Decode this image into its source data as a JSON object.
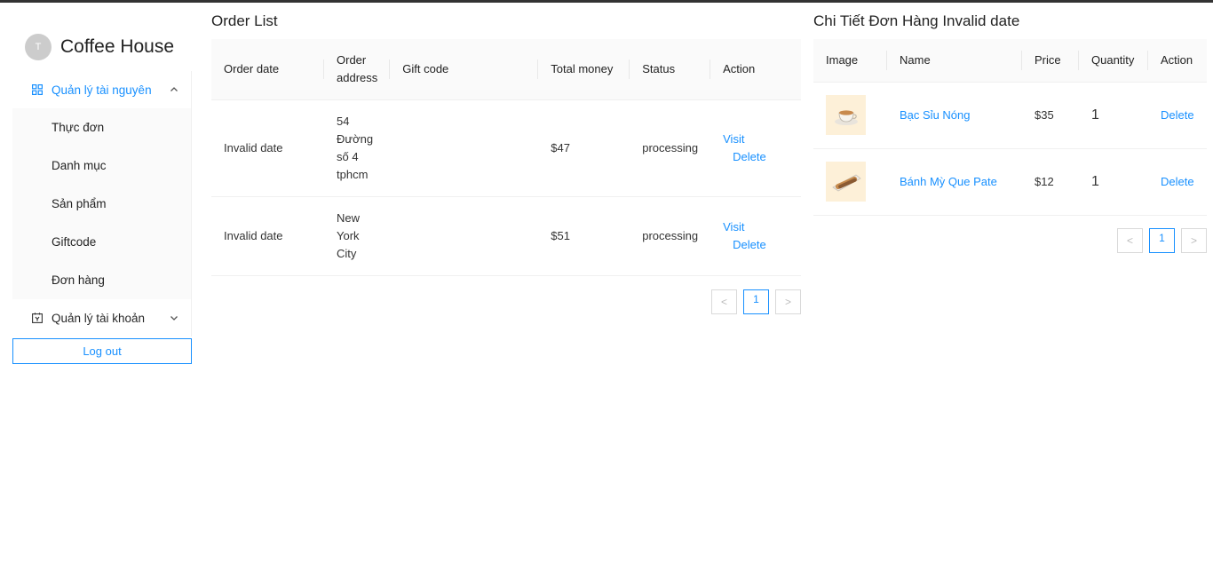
{
  "app": {
    "avatar_letter": "T",
    "brand": "Coffee House"
  },
  "colors": {
    "accent": "#1890ff",
    "header_bg": "#fafafa",
    "thumb_bg": "#fdf0d8"
  },
  "sidebar": {
    "resource_menu": {
      "label": "Quản lý tài nguyên",
      "icon": "appstore-icon",
      "expanded": true,
      "items": [
        "Thực đơn",
        "Danh mục",
        "Sản phẩm",
        "Giftcode",
        "Đơn hàng"
      ]
    },
    "account_menu": {
      "label": "Quản lý tài khoản",
      "icon": "contacts-icon",
      "expanded": false
    },
    "logout_label": "Log out"
  },
  "orders": {
    "title": "Order List",
    "columns": [
      "Order date",
      "Order address",
      "Gift code",
      "Total money",
      "Status",
      "Action"
    ],
    "rows": [
      {
        "date": "Invalid date",
        "address_lines": [
          "54",
          "Đường",
          "số 4",
          "tphcm"
        ],
        "gift_code": "",
        "total": "$47",
        "status": "processing",
        "visit": "Visit",
        "delete": "Delete"
      },
      {
        "date": "Invalid date",
        "address_lines": [
          "New",
          "York",
          "City"
        ],
        "gift_code": "",
        "total": "$51",
        "status": "processing",
        "visit": "Visit",
        "delete": "Delete"
      }
    ],
    "pagination": {
      "prev": "<",
      "current": "1",
      "next": ">"
    }
  },
  "details": {
    "title": "Chi Tiết Đơn Hàng Invalid date",
    "columns": [
      "Image",
      "Name",
      "Price",
      "Quantity",
      "Action"
    ],
    "rows": [
      {
        "image_icon": "coffee-cup-image",
        "name": "Bạc Sỉu Nóng",
        "price": "$35",
        "quantity": "1",
        "delete": "Delete"
      },
      {
        "image_icon": "baguette-image",
        "name": "Bánh Mỳ Que Pate",
        "price": "$12",
        "quantity": "1",
        "delete": "Delete"
      }
    ],
    "pagination": {
      "prev": "<",
      "current": "1",
      "next": ">"
    }
  }
}
